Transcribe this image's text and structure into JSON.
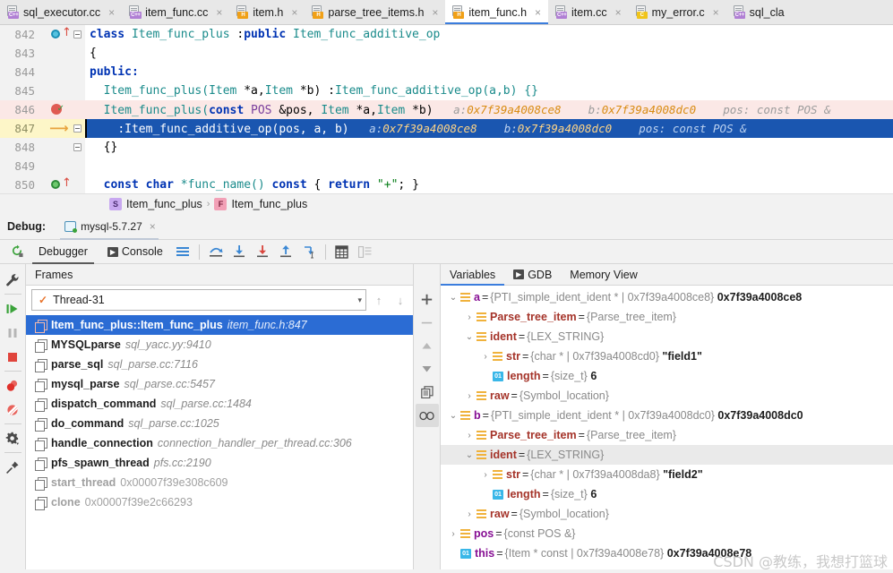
{
  "editor_tabs": [
    {
      "label": "sql_executor.cc",
      "kind": "cpp",
      "badge": "C++",
      "active": false,
      "close": "×"
    },
    {
      "label": "item_func.cc",
      "kind": "cpp",
      "badge": "C++",
      "active": false,
      "close": "×"
    },
    {
      "label": "item.h",
      "kind": "h",
      "badge": "H",
      "active": false,
      "close": "×"
    },
    {
      "label": "parse_tree_items.h",
      "kind": "h",
      "badge": "H",
      "active": false,
      "close": "×"
    },
    {
      "label": "item_func.h",
      "kind": "h",
      "badge": "H",
      "active": true,
      "close": "×"
    },
    {
      "label": "item.cc",
      "kind": "cpp",
      "badge": "C++",
      "active": false,
      "close": "×"
    },
    {
      "label": "my_error.c",
      "kind": "c",
      "badge": "C",
      "active": false,
      "close": "×"
    },
    {
      "label": "sql_cla",
      "kind": "cpp",
      "badge": "C++",
      "active": false,
      "close": ""
    }
  ],
  "code": {
    "lines": [
      {
        "num": "842",
        "gutter": "override-blue"
      },
      {
        "num": "843",
        "gutter": "none"
      },
      {
        "num": "844",
        "gutter": "none"
      },
      {
        "num": "845",
        "gutter": "none"
      },
      {
        "num": "846",
        "gutter": "breakpoint"
      },
      {
        "num": "847",
        "gutter": "exec"
      },
      {
        "num": "848",
        "gutter": "none"
      },
      {
        "num": "849",
        "gutter": "none"
      },
      {
        "num": "850",
        "gutter": "override-green"
      }
    ],
    "l842": {
      "kw": "class",
      "name": "Item_func_plus",
      "colon": " :",
      "pub": "public",
      "base": "Item_func_additive_op"
    },
    "l843": "{",
    "l844": "public:",
    "l845": {
      "fn": "Item_func_plus(",
      "t1": "Item",
      "a1": " *a,",
      "t2": "Item",
      "a2": " *b) :",
      "init": "Item_func_additive_op(a,b) {}"
    },
    "l846": {
      "fn": "Item_func_plus(",
      "kw": "const",
      "pos": " POS",
      "amp": " &pos, ",
      "t1": "Item",
      "a1": " *a,",
      "t2": "Item",
      "a2": " *b)"
    },
    "l846_hints": [
      {
        "label": "a:",
        "value": "0x7f39a4008ce8"
      },
      {
        "label": "b:",
        "value": "0x7f39a4008dc0"
      },
      {
        "label": "pos:",
        "value": "const POS &",
        "plain": true
      }
    ],
    "l847": ":Item_func_additive_op(pos, a, b)",
    "l847_hints": [
      {
        "label": "a:",
        "value": "0x7f39a4008ce8"
      },
      {
        "label": "b:",
        "value": "0x7f39a4008dc0"
      },
      {
        "label": "pos:",
        "value": "const POS &",
        "plain": true
      }
    ],
    "l848": "{}",
    "l849": "",
    "l850": {
      "kw1": "const",
      "t": " char",
      "fn": " *func_name() ",
      "kw2": "const",
      "brace": " { ",
      "kw3": "return",
      "str": " \"+\"",
      "tail": "; }"
    }
  },
  "breadcrumb": {
    "class_badge": "S",
    "class_name": "Item_func_plus",
    "separator": "›",
    "method_badge": "F",
    "method_name": "Item_func_plus"
  },
  "debug": {
    "label": "Debug:",
    "config_name": "mysql-5.7.27",
    "config_close": "×",
    "rerun_icon": "rerun-icon",
    "tabs": [
      {
        "label": "Debugger",
        "active": true
      },
      {
        "label": "Console",
        "active": false
      }
    ],
    "toolbar_icons": [
      "view-breakpoints-icon",
      "step-over-icon",
      "step-into-icon",
      "force-step-into-icon",
      "step-out-icon",
      "run-to-cursor-icon",
      "evaluate-expression-icon",
      "layout-icon"
    ]
  },
  "rail_icons": [
    "wrench-icon",
    "resume-program-icon",
    "pause-program-icon",
    "stop-icon",
    "view-breakpoints-icon",
    "mute-breakpoints-icon",
    "settings-icon",
    "pin-icon"
  ],
  "frames": {
    "title": "Frames",
    "thread": {
      "name": "Thread-31",
      "check": "✓",
      "caret": "▾"
    },
    "up_arrow": "↑",
    "down_arrow": "↓",
    "items": [
      {
        "fn": "Item_func_plus::Item_func_plus",
        "loc": "item_func.h:847",
        "selected": true,
        "dim": false
      },
      {
        "fn": "MYSQLparse",
        "loc": "sql_yacc.yy:9410",
        "selected": false,
        "dim": false
      },
      {
        "fn": "parse_sql",
        "loc": "sql_parse.cc:7116",
        "selected": false,
        "dim": false
      },
      {
        "fn": "mysql_parse",
        "loc": "sql_parse.cc:5457",
        "selected": false,
        "dim": false
      },
      {
        "fn": "dispatch_command",
        "loc": "sql_parse.cc:1484",
        "selected": false,
        "dim": false
      },
      {
        "fn": "do_command",
        "loc": "sql_parse.cc:1025",
        "selected": false,
        "dim": false
      },
      {
        "fn": "handle_connection",
        "loc": "connection_handler_per_thread.cc:306",
        "selected": false,
        "dim": false
      },
      {
        "fn": "pfs_spawn_thread",
        "loc": "pfs.cc:2190",
        "selected": false,
        "dim": false
      },
      {
        "fn": "start_thread",
        "loc": "0x00007f39e308c609",
        "selected": false,
        "dim": true
      },
      {
        "fn": "clone",
        "loc": "0x00007f39e2c66293",
        "selected": false,
        "dim": true
      }
    ]
  },
  "variables": {
    "tabs": [
      {
        "label": "Variables",
        "active": true,
        "icon": ""
      },
      {
        "label": "GDB",
        "active": false,
        "icon": "gdb-icon"
      },
      {
        "label": "Memory View",
        "active": false,
        "icon": ""
      }
    ],
    "toolbar_icons": [
      "add-watch-icon",
      "remove-watch-icon",
      "up-icon",
      "down-icon",
      "copy-icon",
      "watches-icon"
    ],
    "rows": [
      {
        "indent": 0,
        "twisty": "⌄",
        "icon": "struct",
        "name": "a",
        "name_kind": "var",
        "type": "{PTI_simple_ident_ident * | 0x7f39a4008ce8}",
        "value": "0x7f39a4008ce8",
        "selected": false
      },
      {
        "indent": 1,
        "twisty": "›",
        "icon": "struct",
        "name": "Parse_tree_item",
        "name_kind": "field",
        "type": "{Parse_tree_item}",
        "value": "",
        "selected": false
      },
      {
        "indent": 1,
        "twisty": "⌄",
        "icon": "struct",
        "name": "ident",
        "name_kind": "field",
        "type": "{LEX_STRING}",
        "value": "",
        "selected": false
      },
      {
        "indent": 2,
        "twisty": "›",
        "icon": "struct",
        "name": "str",
        "name_kind": "field",
        "type": "{char * | 0x7f39a4008cd0}",
        "value": "\"field1\"",
        "selected": false
      },
      {
        "indent": 2,
        "twisty": "",
        "icon": "prim",
        "name": "length",
        "name_kind": "field",
        "type": "{size_t}",
        "value": "6",
        "selected": false
      },
      {
        "indent": 1,
        "twisty": "›",
        "icon": "struct",
        "name": "raw",
        "name_kind": "field",
        "type": "{Symbol_location}",
        "value": "",
        "selected": false
      },
      {
        "indent": 0,
        "twisty": "⌄",
        "icon": "struct",
        "name": "b",
        "name_kind": "var",
        "type": "{PTI_simple_ident_ident * | 0x7f39a4008dc0}",
        "value": "0x7f39a4008dc0",
        "selected": false
      },
      {
        "indent": 1,
        "twisty": "›",
        "icon": "struct",
        "name": "Parse_tree_item",
        "name_kind": "field",
        "type": "{Parse_tree_item}",
        "value": "",
        "selected": false
      },
      {
        "indent": 1,
        "twisty": "⌄",
        "icon": "struct",
        "name": "ident",
        "name_kind": "field",
        "type": "{LEX_STRING}",
        "value": "",
        "selected": true
      },
      {
        "indent": 2,
        "twisty": "›",
        "icon": "struct",
        "name": "str",
        "name_kind": "field",
        "type": "{char * | 0x7f39a4008da8}",
        "value": "\"field2\"",
        "selected": false
      },
      {
        "indent": 2,
        "twisty": "",
        "icon": "prim",
        "name": "length",
        "name_kind": "field",
        "type": "{size_t}",
        "value": "6",
        "selected": false
      },
      {
        "indent": 1,
        "twisty": "›",
        "icon": "struct",
        "name": "raw",
        "name_kind": "field",
        "type": "{Symbol_location}",
        "value": "",
        "selected": false
      },
      {
        "indent": 0,
        "twisty": "›",
        "icon": "struct",
        "name": "pos",
        "name_kind": "var",
        "type": "{const POS &}",
        "value": "",
        "selected": false
      },
      {
        "indent": 0,
        "twisty": "",
        "icon": "prim",
        "name": "this",
        "name_kind": "var",
        "type": "{Item * const | 0x7f39a4008e78}",
        "value": "0x7f39a4008e78",
        "selected": false
      }
    ],
    "prim_badge": "01"
  },
  "watermark": "CSDN @教练，我想打篮球",
  "colors": {
    "accent_blue": "#3b7ddd",
    "selection_blue": "#2b6cd4",
    "exec_line": "#1a56b0",
    "breakpoint_red": "#e05a52",
    "breakpoint_line": "#fbe8e6",
    "exec_gutter": "#fdf6c8"
  }
}
